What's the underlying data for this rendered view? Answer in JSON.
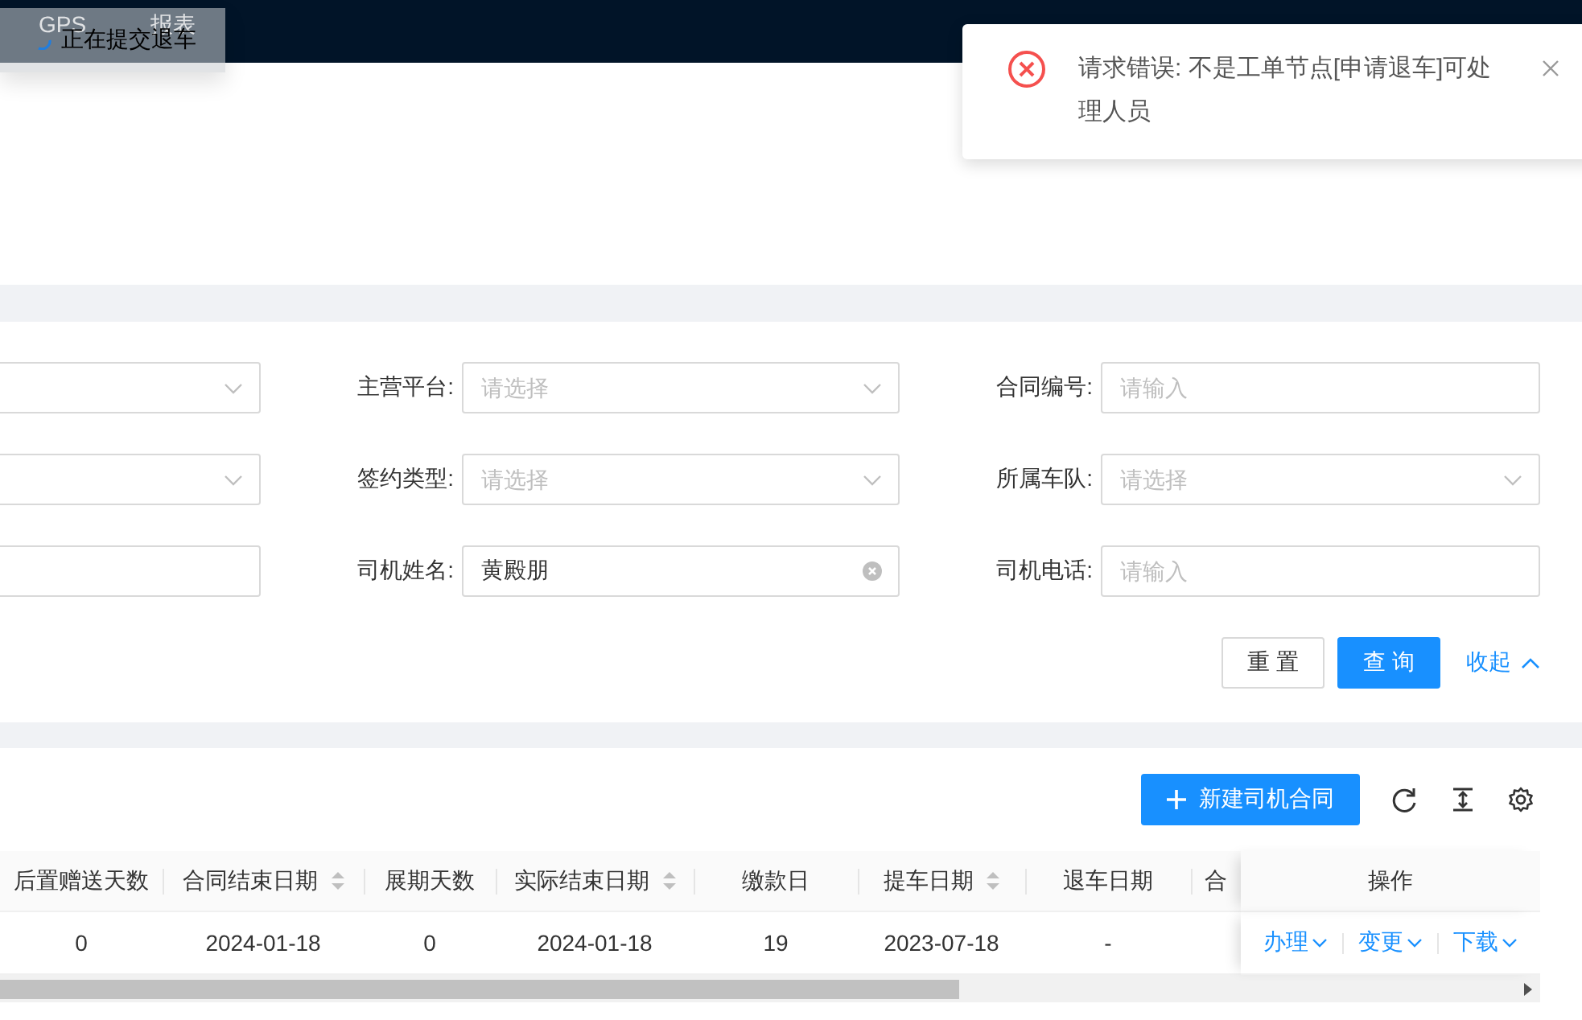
{
  "nav": {
    "items": [
      {
        "label": "GPS"
      },
      {
        "label": "报表"
      }
    ]
  },
  "loading_toast": {
    "text": "正在提交退车"
  },
  "notification": {
    "kind": "error",
    "message": "请求错误: 不是工单节点[申请退车]可处理人员"
  },
  "query_form": {
    "fields": [
      {
        "kind": "select"
      },
      {
        "kind": "select",
        "label": "主营平台:",
        "placeholder": "请选择"
      },
      {
        "kind": "input",
        "label": "合同编号:",
        "placeholder": "请输入"
      },
      {
        "kind": "select"
      },
      {
        "kind": "select",
        "label": "签约类型:",
        "placeholder": "请选择"
      },
      {
        "kind": "select",
        "label": "所属车队:",
        "placeholder": "请选择"
      },
      {
        "kind": "input"
      },
      {
        "kind": "input",
        "label": "司机姓名:",
        "value": "黄殿朋"
      },
      {
        "kind": "input",
        "label": "司机电话:",
        "placeholder": "请输入"
      }
    ],
    "buttons": [
      {
        "label": "重 置",
        "kind": "default"
      },
      {
        "label": "查 询",
        "kind": "primary"
      }
    ],
    "collapse_link": {
      "label": "收起",
      "expanded": true
    }
  },
  "table": {
    "new_button": "新建司机合同",
    "columns": [
      {
        "title": "后置赠送天数",
        "sortable": false
      },
      {
        "title": "合同结束日期",
        "sortable": true
      },
      {
        "title": "展期天数",
        "sortable": false
      },
      {
        "title": "实际结束日期",
        "sortable": true
      },
      {
        "title": "缴款日",
        "sortable": false
      },
      {
        "title": "提车日期",
        "sortable": true
      },
      {
        "title": "退车日期",
        "sortable": false
      },
      {
        "title": "合",
        "sortable": false
      }
    ],
    "action_column": "操作",
    "rows": [
      {
        "cells": [
          "0",
          "2024-01-18",
          "0",
          "2024-01-18",
          "19",
          "2023-07-18",
          "-"
        ],
        "actions": [
          "办理",
          "变更",
          "下载"
        ]
      }
    ]
  }
}
